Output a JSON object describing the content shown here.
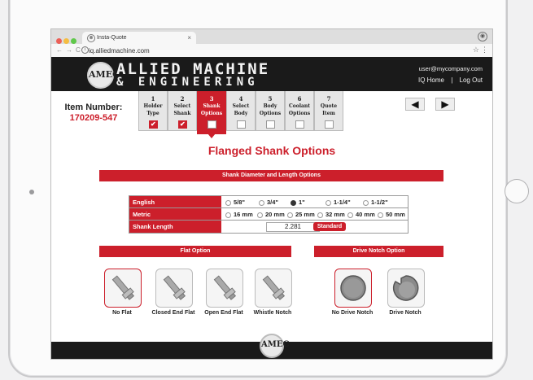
{
  "browser": {
    "tab_title": "Insta-Quote",
    "tab_close": "×",
    "url": "iq.alliedmachine.com",
    "star": "☆",
    "menu": "⋮",
    "traffic_colors": [
      "#ec5f57",
      "#f5bd41",
      "#5fc84a"
    ]
  },
  "header": {
    "logo_text": "AMEC",
    "brand_line1": "ALLIED MACHINE",
    "brand_line2": "& ENGINEERING",
    "user_email": "user@mycompany.com",
    "link_home": "IQ Home",
    "link_sep": "|",
    "link_logout": "Log Out"
  },
  "item": {
    "label": "Item Number:",
    "value": "170209-547"
  },
  "steps": [
    {
      "num": "1",
      "label1": "Holder",
      "label2": "Type",
      "state": "done"
    },
    {
      "num": "2",
      "label1": "Select",
      "label2": "Shank",
      "state": "done"
    },
    {
      "num": "3",
      "label1": "Shank",
      "label2": "Options",
      "state": "active"
    },
    {
      "num": "4",
      "label1": "Select",
      "label2": "Body",
      "state": "todo"
    },
    {
      "num": "5",
      "label1": "Body",
      "label2": "Options",
      "state": "todo"
    },
    {
      "num": "6",
      "label1": "Coolant",
      "label2": "Options",
      "state": "todo"
    },
    {
      "num": "7",
      "label1": "Quote",
      "label2": "Item",
      "state": "todo"
    }
  ],
  "nav": {
    "prev": "◀",
    "next": "▶"
  },
  "page_title": "Flanged Shank Options",
  "section_diameter": "Shank Diameter and Length Options",
  "english": {
    "label": "English",
    "options": [
      "5/8\"",
      "3/4\"",
      "1\"",
      "1-1/4\"",
      "1-1/2\""
    ],
    "selected": 2
  },
  "metric": {
    "label": "Metric",
    "options": [
      "16 mm",
      "20 mm",
      "25 mm",
      "32 mm",
      "40 mm",
      "50 mm"
    ],
    "selected": -1
  },
  "shank_length": {
    "label": "Shank Length",
    "value": "2.281",
    "button": "Standard"
  },
  "section_flat": "Flat Option",
  "flat_options": [
    "No Flat",
    "Closed End Flat",
    "Open End Flat",
    "Whistle Notch"
  ],
  "flat_selected": 0,
  "section_drive": "Drive Notch Option",
  "drive_options": [
    "No Drive Notch",
    "Drive Notch"
  ],
  "drive_selected": 0,
  "footer": {
    "logo_text": "AMEC"
  },
  "colors": {
    "accent": "#cc1f2b",
    "header_bg": "#1a1a1a"
  }
}
